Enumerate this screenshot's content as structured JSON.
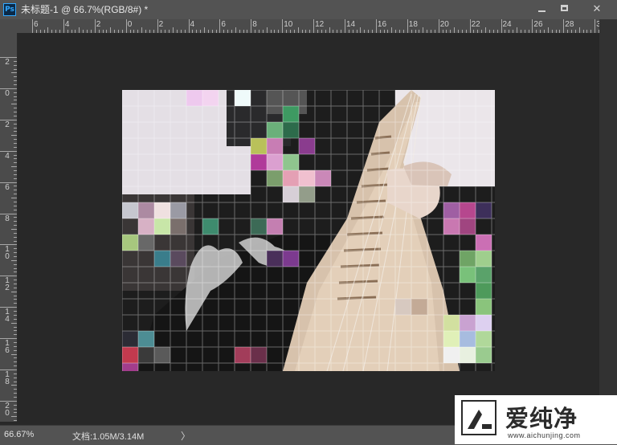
{
  "app": {
    "icon_label": "Ps"
  },
  "document": {
    "title": "未标题-1 @ 66.7%(RGB/8#) *"
  },
  "window_controls": {
    "minimize": "minimize",
    "maximize": "maximize",
    "close": "✕"
  },
  "ruler_h": {
    "labels": [
      "6",
      "4",
      "2",
      "0",
      "2",
      "4",
      "6",
      "8",
      "10",
      "12",
      "14",
      "16",
      "18",
      "20",
      "22",
      "24",
      "26",
      "28",
      "30"
    ]
  },
  "ruler_v": {
    "labels": [
      [
        "2"
      ],
      [
        "0"
      ],
      [
        "2"
      ],
      [
        "4"
      ],
      [
        "6"
      ],
      [
        "8"
      ],
      [
        "1",
        "0"
      ],
      [
        "1",
        "2"
      ],
      [
        "1",
        "4"
      ],
      [
        "1",
        "6"
      ],
      [
        "1",
        "8"
      ],
      [
        "2",
        "0"
      ]
    ]
  },
  "status": {
    "zoom": "66.67%",
    "doc_info": "文档:1.05M/3.14M",
    "arrow": "〉"
  },
  "watermark": {
    "text": "爱纯净",
    "url": "www.aichunjing.com"
  },
  "colors": {
    "ps_blue": "#31a8ff",
    "panel": "#535353",
    "pasteboard": "#282828"
  }
}
